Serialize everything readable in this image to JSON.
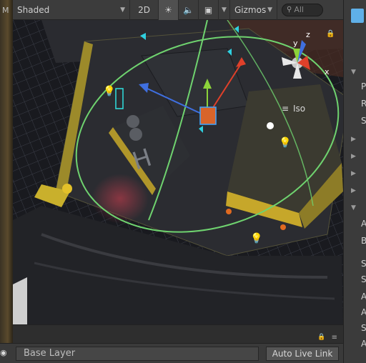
{
  "left_panel": {
    "letter": "M"
  },
  "toolbar": {
    "shading_mode": "Shaded",
    "mode_2d": "2D",
    "sun_icon": "sun-icon",
    "audio_icon": "speaker-icon",
    "image_icon": "image-effects-icon",
    "gizmos_label": "Gizmos",
    "search_placeholder": "All"
  },
  "scene": {
    "projection_label": "Iso",
    "orientation_axes": {
      "x": "x",
      "y": "y",
      "z": "z"
    },
    "colors": {
      "selection_ring": "#6fd36f",
      "axis_x": "#e0402a",
      "axis_y": "#8cd33a",
      "axis_z": "#3f6fe0"
    }
  },
  "inspector": {
    "letters": [
      "P",
      "R",
      "S",
      "A",
      "B",
      "S",
      "S",
      "A",
      "A",
      "S",
      "A"
    ]
  },
  "animator": {
    "layer_label": "Base Layer",
    "live_link_label": "Auto Live Link"
  }
}
